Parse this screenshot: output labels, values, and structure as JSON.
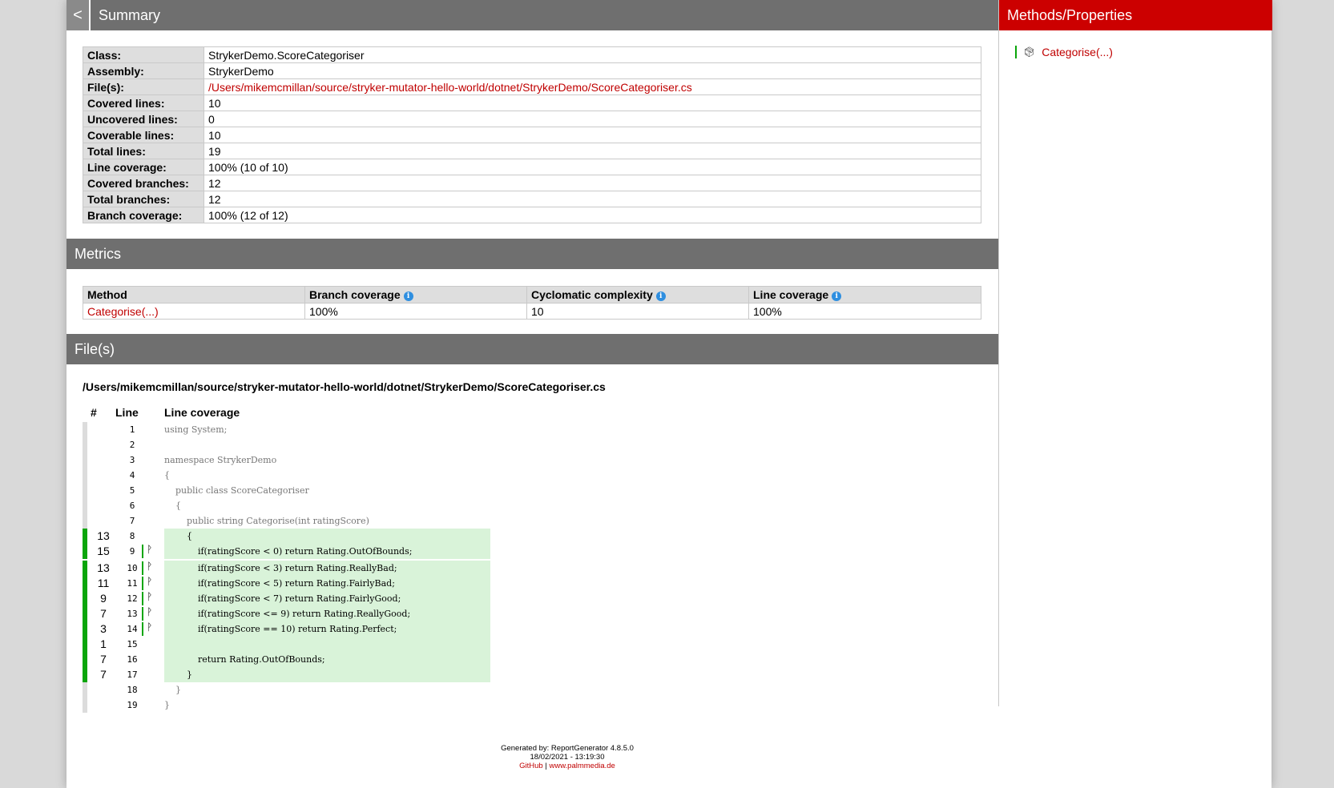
{
  "header": {
    "back_label": "<",
    "title": "Summary"
  },
  "summary": {
    "rows": [
      {
        "key": "Class:",
        "value": "StrykerDemo.ScoreCategoriser"
      },
      {
        "key": "Assembly:",
        "value": "StrykerDemo"
      },
      {
        "key": "File(s):",
        "value": "/Users/mikemcmillan/source/stryker-mutator-hello-world/dotnet/StrykerDemo/ScoreCategoriser.cs"
      },
      {
        "key": "Covered lines:",
        "value": "10"
      },
      {
        "key": "Uncovered lines:",
        "value": "0"
      },
      {
        "key": "Coverable lines:",
        "value": "10"
      },
      {
        "key": "Total lines:",
        "value": "19"
      },
      {
        "key": "Line coverage:",
        "value": "100% (10 of 10)"
      },
      {
        "key": "Covered branches:",
        "value": "12"
      },
      {
        "key": "Total branches:",
        "value": "12"
      },
      {
        "key": "Branch coverage:",
        "value": "100% (12 of 12)"
      }
    ]
  },
  "metrics": {
    "title": "Metrics",
    "columns": [
      "Method",
      "Branch coverage",
      "Cyclomatic complexity",
      "Line coverage"
    ],
    "row": {
      "method": "Categorise(...)",
      "branch": "100%",
      "cyclomatic": "10",
      "line": "100%"
    }
  },
  "files": {
    "title": "File(s)",
    "path": "/Users/mikemcmillan/source/stryker-mutator-hello-world/dotnet/StrykerDemo/ScoreCategoriser.cs",
    "col_hash": "#",
    "col_line": "Line",
    "col_coverage": "Line coverage",
    "lines": [
      {
        "n": "1",
        "hits": "",
        "branch": false,
        "covered": false,
        "code": "using System;"
      },
      {
        "n": "2",
        "hits": "",
        "branch": false,
        "covered": false,
        "code": ""
      },
      {
        "n": "3",
        "hits": "",
        "branch": false,
        "covered": false,
        "code": "namespace StrykerDemo"
      },
      {
        "n": "4",
        "hits": "",
        "branch": false,
        "covered": false,
        "code": "{"
      },
      {
        "n": "5",
        "hits": "",
        "branch": false,
        "covered": false,
        "code": "    public class ScoreCategoriser"
      },
      {
        "n": "6",
        "hits": "",
        "branch": false,
        "covered": false,
        "code": "    {"
      },
      {
        "n": "7",
        "hits": "",
        "branch": false,
        "covered": false,
        "code": "        public string Categorise(int ratingScore)"
      },
      {
        "n": "8",
        "hits": "13",
        "branch": false,
        "covered": true,
        "code": "        {"
      },
      {
        "n": "9",
        "hits": "15",
        "branch": true,
        "covered": true,
        "code": "            if(ratingScore < 0) return Rating.OutOfBounds;"
      },
      {
        "n": "10",
        "hits": "13",
        "branch": true,
        "covered": true,
        "code": "            if(ratingScore < 3) return Rating.ReallyBad;"
      },
      {
        "n": "11",
        "hits": "11",
        "branch": true,
        "covered": true,
        "code": "            if(ratingScore < 5) return Rating.FairlyBad;"
      },
      {
        "n": "12",
        "hits": "9",
        "branch": true,
        "covered": true,
        "code": "            if(ratingScore < 7) return Rating.FairlyGood;"
      },
      {
        "n": "13",
        "hits": "7",
        "branch": true,
        "covered": true,
        "code": "            if(ratingScore <= 9) return Rating.ReallyGood;"
      },
      {
        "n": "14",
        "hits": "3",
        "branch": true,
        "covered": true,
        "code": "            if(ratingScore == 10) return Rating.Perfect;"
      },
      {
        "n": "15",
        "hits": "1",
        "branch": false,
        "covered": true,
        "code": ""
      },
      {
        "n": "16",
        "hits": "7",
        "branch": false,
        "covered": true,
        "code": "            return Rating.OutOfBounds;"
      },
      {
        "n": "17",
        "hits": "7",
        "branch": false,
        "covered": true,
        "code": "        }"
      },
      {
        "n": "18",
        "hits": "",
        "branch": false,
        "covered": false,
        "code": "    }"
      },
      {
        "n": "19",
        "hits": "",
        "branch": false,
        "covered": false,
        "code": "}"
      }
    ]
  },
  "sidebar": {
    "title": "Methods/Properties",
    "items": [
      {
        "label": "Categorise(...)",
        "icon": "cube-icon"
      }
    ]
  },
  "footer": {
    "generated": "Generated by: ReportGenerator 4.8.5.0",
    "date": "18/02/2021 - 13:19:30",
    "github": "GitHub",
    "separator": "|",
    "website": "www.palmmedia.de"
  },
  "colors": {
    "accent": "#cc0000",
    "bar": "#6f6f6f",
    "covered": "#0aa50a",
    "covered_bg": "#d9f3d9"
  }
}
